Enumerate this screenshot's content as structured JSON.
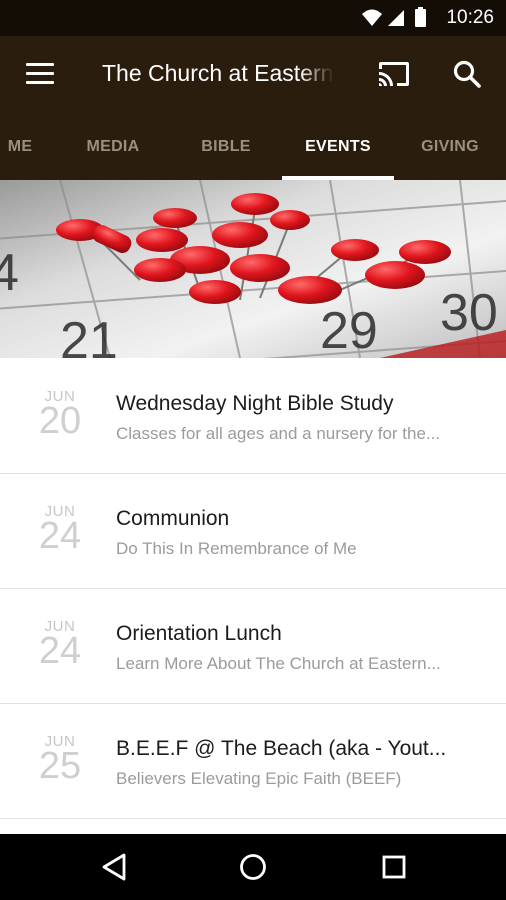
{
  "status_bar": {
    "time": "10:26",
    "icons": [
      "wifi-icon",
      "signal-icon",
      "battery-icon"
    ]
  },
  "app_bar": {
    "title": "The Church at Eastern",
    "menu_icon": "menu-icon",
    "cast_icon": "cast-icon",
    "search_icon": "search-icon"
  },
  "tabs": [
    {
      "label": "ME",
      "active": false
    },
    {
      "label": "MEDIA",
      "active": false
    },
    {
      "label": "BIBLE",
      "active": false
    },
    {
      "label": "EVENTS",
      "active": true
    },
    {
      "label": "GIVING",
      "active": false
    }
  ],
  "hero": {
    "image": "calendar-with-red-pushpins"
  },
  "events": [
    {
      "month": "JUN",
      "day": "20",
      "title": "Wednesday Night Bible Study",
      "subtitle": "Classes for all ages and a nursery for the..."
    },
    {
      "month": "JUN",
      "day": "24",
      "title": "Communion",
      "subtitle": "Do This In Remembrance of Me"
    },
    {
      "month": "JUN",
      "day": "24",
      "title": "Orientation Lunch",
      "subtitle": "Learn More About The Church at Eastern..."
    },
    {
      "month": "JUN",
      "day": "25",
      "title": "B.E.E.F @ The Beach (aka - Yout...",
      "subtitle": "Believers Elevating Epic Faith (BEEF)"
    }
  ],
  "nav_bar": {
    "buttons": [
      "back-icon",
      "home-icon",
      "recents-icon"
    ]
  },
  "colors": {
    "app_bar": "#2a1d0e",
    "status_bar": "#130d06",
    "tab_inactive": "#9a8f84",
    "tab_active": "#ffffff",
    "date_text": "#c6c6c6",
    "pin_red": "#d9141c"
  }
}
